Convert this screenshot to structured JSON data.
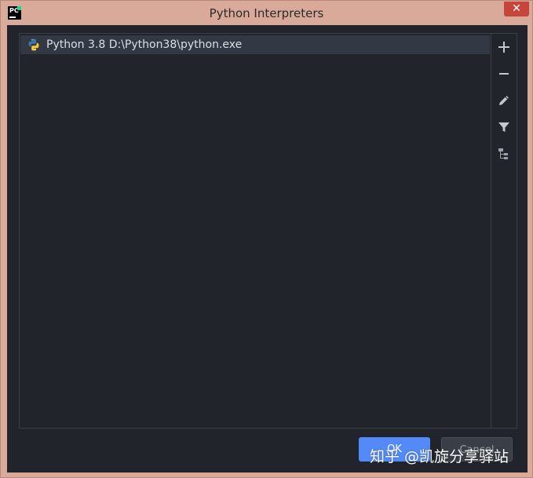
{
  "window": {
    "title": "Python Interpreters",
    "app_icon_text": "PC",
    "close_glyph": "✕"
  },
  "interpreters": [
    {
      "label": "Python 3.8 D:\\Python38\\python.exe",
      "icon": "python-icon",
      "selected": true
    }
  ],
  "toolbar": {
    "icons": [
      "add-icon",
      "remove-icon",
      "edit-icon",
      "filter-icon",
      "show-paths-icon"
    ]
  },
  "buttons": {
    "ok": "OK",
    "cancel": "Cancel"
  },
  "watermark": {
    "text": "知乎 @凯旋分享驿站"
  },
  "colors": {
    "accent": "#548af7",
    "background": "#21252b",
    "selection": "#323844",
    "close": "#c7463b"
  }
}
